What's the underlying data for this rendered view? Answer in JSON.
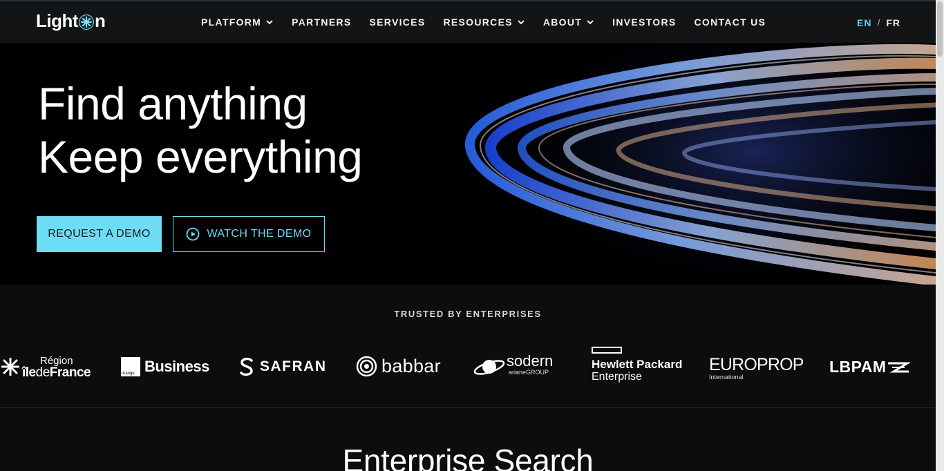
{
  "brand": {
    "name_left": "Light",
    "name_right": "n",
    "icon": "sparkle-o-icon"
  },
  "nav": {
    "items": [
      {
        "label": "PLATFORM",
        "has_dropdown": true
      },
      {
        "label": "PARTNERS",
        "has_dropdown": false
      },
      {
        "label": "SERVICES",
        "has_dropdown": false
      },
      {
        "label": "RESOURCES",
        "has_dropdown": true
      },
      {
        "label": "ABOUT",
        "has_dropdown": true
      },
      {
        "label": "INVESTORS",
        "has_dropdown": false
      },
      {
        "label": "CONTACT US",
        "has_dropdown": false
      }
    ]
  },
  "lang": {
    "en": "EN",
    "sep": "/",
    "fr": "FR",
    "active": "EN"
  },
  "hero": {
    "title_line1": "Find anything",
    "title_line2": "Keep everything",
    "primary_cta": "REQUEST A DEMO",
    "secondary_cta": "WATCH THE DEMO"
  },
  "trusted": {
    "title": "TRUSTED BY ENTERPRISES",
    "logos": {
      "idf_top": "Région",
      "idf_ile": "île",
      "idf_de": "de",
      "idf_france": "France",
      "orange_small": "orange",
      "orange_business": "Business",
      "safran": "SAFRAN",
      "babbar": "babbar",
      "sodern": "sodern",
      "sodern_sub": "arianeGROUP",
      "hpe_line1": "Hewlett Packard",
      "hpe_line2": "Enterprise",
      "europrop": "EUROPROP",
      "europrop_sub": "International",
      "lbpam": "LBPAM"
    }
  },
  "next_section": {
    "title": "Enterprise Search"
  },
  "colors": {
    "accent": "#6fdcf5",
    "background": "#0d0d0e",
    "header": "#131416"
  }
}
